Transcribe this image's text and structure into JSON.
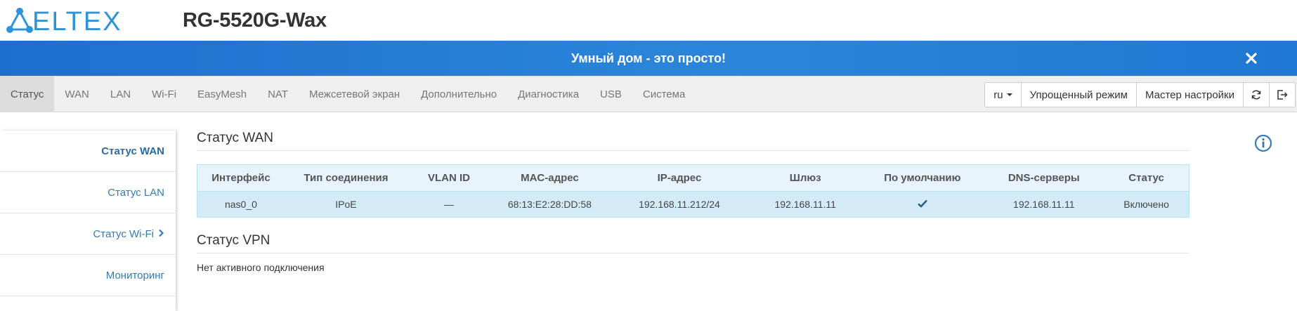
{
  "header": {
    "brand": "ELTEX",
    "device_model": "RG-5520G-Wax"
  },
  "banner": {
    "text": "Умный дом - это просто!"
  },
  "nav": {
    "tabs": [
      {
        "label": "Статус",
        "active": true
      },
      {
        "label": "WAN"
      },
      {
        "label": "LAN"
      },
      {
        "label": "Wi-Fi"
      },
      {
        "label": "EasyMesh"
      },
      {
        "label": "NAT"
      },
      {
        "label": "Межсетевой экран"
      },
      {
        "label": "Дополнительно"
      },
      {
        "label": "Диагностика"
      },
      {
        "label": "USB"
      },
      {
        "label": "Система"
      }
    ],
    "language": "ru",
    "simple_mode": "Упрощенный режим",
    "setup_wizard": "Мастер настройки"
  },
  "sidebar": {
    "items": [
      {
        "label": "Статус WAN",
        "active": true
      },
      {
        "label": "Статус LAN"
      },
      {
        "label": "Статус Wi-Fi",
        "has_submenu": true
      },
      {
        "label": "Мониторинг"
      }
    ]
  },
  "wan": {
    "title": "Статус WAN",
    "columns": [
      "Интерфейс",
      "Тип соединения",
      "VLAN ID",
      "MAC-адрес",
      "IP-адрес",
      "Шлюз",
      "По умолчанию",
      "DNS-серверы",
      "Статус"
    ],
    "rows": [
      {
        "interface": "nas0_0",
        "type": "IPoE",
        "vlan": "—",
        "mac": "68:13:E2:28:DD:58",
        "ip": "192.168.11.212/24",
        "gateway": "192.168.11.11",
        "default": true,
        "dns": "192.168.11.11",
        "status": "Включено"
      }
    ]
  },
  "vpn": {
    "title": "Статус VPN",
    "message": "Нет активного подключения"
  },
  "colors": {
    "brand_blue": "#2b86db",
    "link_blue": "#337ab7",
    "table_row": "#d3ebf6"
  }
}
